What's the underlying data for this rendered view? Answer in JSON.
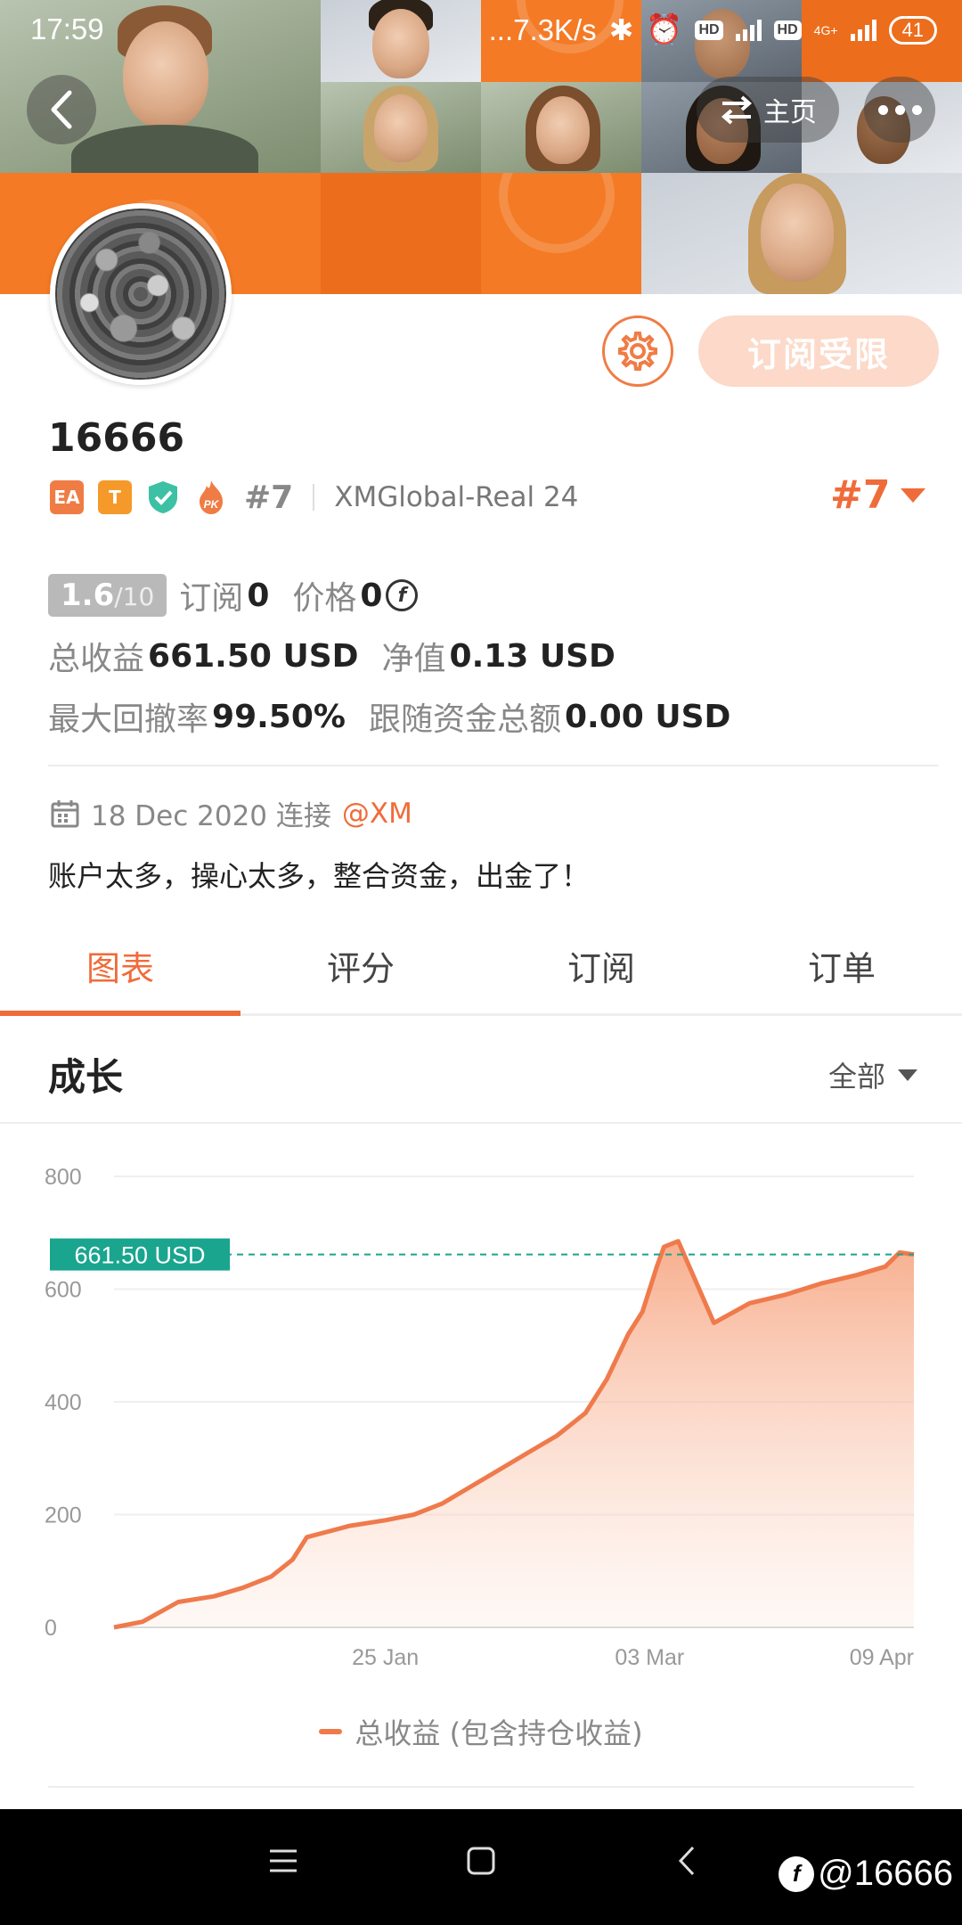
{
  "status_bar": {
    "time": "17:59",
    "speed": "...7.3K/s",
    "hd1": "HD",
    "hd2": "HD",
    "network": "4G+",
    "battery": "41"
  },
  "header": {
    "home_label": "主页"
  },
  "profile": {
    "username": "16666",
    "badges": [
      "EA",
      "T"
    ],
    "rank": "#7",
    "server": "XMGlobal-Real 24",
    "rank_right": "#7",
    "subscribe_label": "订阅受限"
  },
  "stats": {
    "score": "1.6",
    "score_max": "/10",
    "subscribe_label": "订阅",
    "subscribe_value": "0",
    "price_label": "价格",
    "price_value": "0",
    "profit_label": "总收益",
    "profit_value": "661.50 USD",
    "equity_label": "净值",
    "equity_value": "0.13 USD",
    "drawdown_label": "最大回撤率",
    "drawdown_value": "99.50%",
    "follow_label": "跟随资金总额",
    "follow_value": "0.00 USD"
  },
  "connection": {
    "date_text": "18 Dec 2020 连接",
    "broker": "@XM"
  },
  "bio": "账户太多，操心太多，整合资金，出金了！",
  "tabs": [
    {
      "label": "图表",
      "active": true
    },
    {
      "label": "评分",
      "active": false
    },
    {
      "label": "订阅",
      "active": false
    },
    {
      "label": "订单",
      "active": false
    }
  ],
  "chart_section": {
    "title": "成长",
    "filter": "全部",
    "current_label": "661.50 USD",
    "legend": "总收益 (包含持仓收益)"
  },
  "colors": {
    "accent": "#ef6c3a",
    "line": "#ef7a4c",
    "current_tag": "#1aa58f"
  },
  "chart_data": {
    "type": "area",
    "ylim": [
      0,
      800
    ],
    "yticks": [
      "800",
      "600",
      "400",
      "200",
      "0"
    ],
    "ytick_values": [
      800,
      600,
      400,
      200,
      0
    ],
    "xtick_labels": [
      "25 Jan",
      "03 Mar",
      "09 Apr"
    ],
    "xtick_dates": [
      "2021-01-25",
      "2021-03-03",
      "2021-04-09"
    ],
    "x_start": "2020-12-18",
    "x_end": "2021-04-09",
    "current_value": 661.5,
    "series": [
      {
        "name": "总收益 (包含持仓收益)",
        "x": [
          "2020-12-18",
          "2020-12-22",
          "2020-12-27",
          "2021-01-01",
          "2021-01-05",
          "2021-01-09",
          "2021-01-12",
          "2021-01-14",
          "2021-01-20",
          "2021-01-25",
          "2021-01-29",
          "2021-02-02",
          "2021-02-06",
          "2021-02-10",
          "2021-02-14",
          "2021-02-18",
          "2021-02-22",
          "2021-02-25",
          "2021-02-28",
          "2021-03-02",
          "2021-03-04",
          "2021-03-05",
          "2021-03-07",
          "2021-03-12",
          "2021-03-17",
          "2021-03-22",
          "2021-03-27",
          "2021-04-01",
          "2021-04-05",
          "2021-04-07",
          "2021-04-09"
        ],
        "values": [
          0,
          10,
          45,
          55,
          70,
          90,
          120,
          160,
          180,
          190,
          200,
          220,
          250,
          280,
          310,
          340,
          380,
          440,
          520,
          560,
          640,
          675,
          685,
          540,
          575,
          590,
          610,
          625,
          640,
          665,
          661.5
        ]
      }
    ]
  },
  "nav": {
    "watermark": "@16666"
  }
}
